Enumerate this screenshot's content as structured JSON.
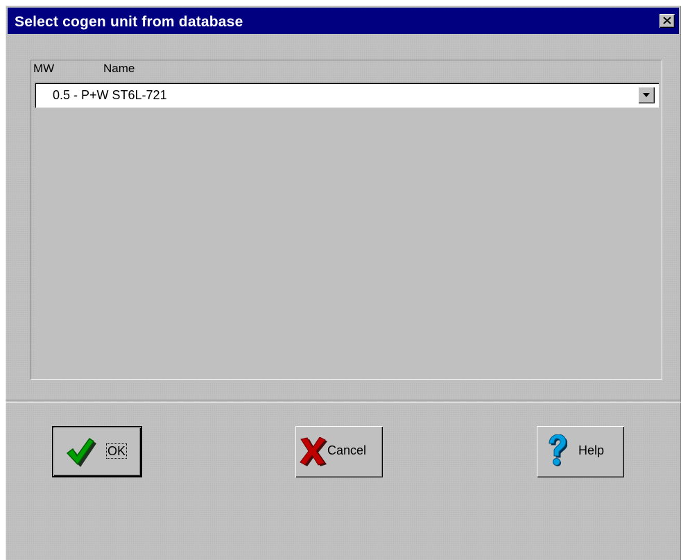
{
  "window": {
    "title": "Select cogen unit from database"
  },
  "columns": {
    "mw": "MW",
    "name": "Name"
  },
  "combo": {
    "selected_value": "0.5 - P+W ST6L-721"
  },
  "buttons": {
    "ok": "OK",
    "cancel": "Cancel",
    "help": "Help"
  },
  "icons": {
    "close": "close-icon",
    "dropdown": "chevron-down-icon",
    "ok": "checkmark-icon",
    "cancel": "x-mark-icon",
    "help": "question-mark-icon"
  },
  "colors": {
    "titlebar": "#000080",
    "face": "#c0c0c0",
    "ok_icon": "#008000",
    "cancel_icon": "#b00000",
    "help_icon": "#0088cc"
  }
}
